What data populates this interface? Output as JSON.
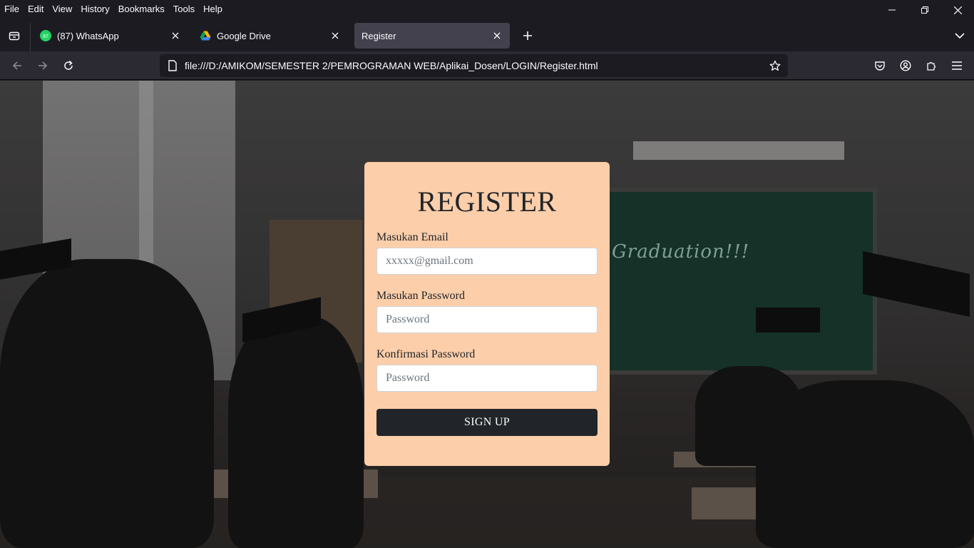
{
  "menubar": {
    "items": [
      "File",
      "Edit",
      "View",
      "History",
      "Bookmarks",
      "Tools",
      "Help"
    ]
  },
  "tabs": [
    {
      "title": "(87) WhatsApp",
      "badge": "87",
      "icon": "whatsapp-icon",
      "active": false
    },
    {
      "title": "Google Drive",
      "icon": "google-drive-icon",
      "active": false
    },
    {
      "title": "Register",
      "icon": "",
      "active": true
    }
  ],
  "navbar": {
    "url": "file:///D:/AMIKOM/SEMESTER 2/PEMROGRAMAN WEB/Aplikai_Dosen/LOGIN/Register.html"
  },
  "form": {
    "title": "REGISTER",
    "email_label": "Masukan Email",
    "email_placeholder": "xxxxx@gmail.com",
    "password_label": "Masukan Password",
    "password_placeholder": "Password",
    "confirm_label": "Konfirmasi Password",
    "confirm_placeholder": "Password",
    "submit_label": "SIGN UP"
  },
  "background": {
    "chalkboard_text": "Graduation!!!"
  },
  "colors": {
    "card_bg": "#fcceaa",
    "button_bg": "#212529",
    "chrome_dark": "#1c1b22",
    "toolbar": "#2b2a33",
    "active_tab": "#42414d"
  }
}
